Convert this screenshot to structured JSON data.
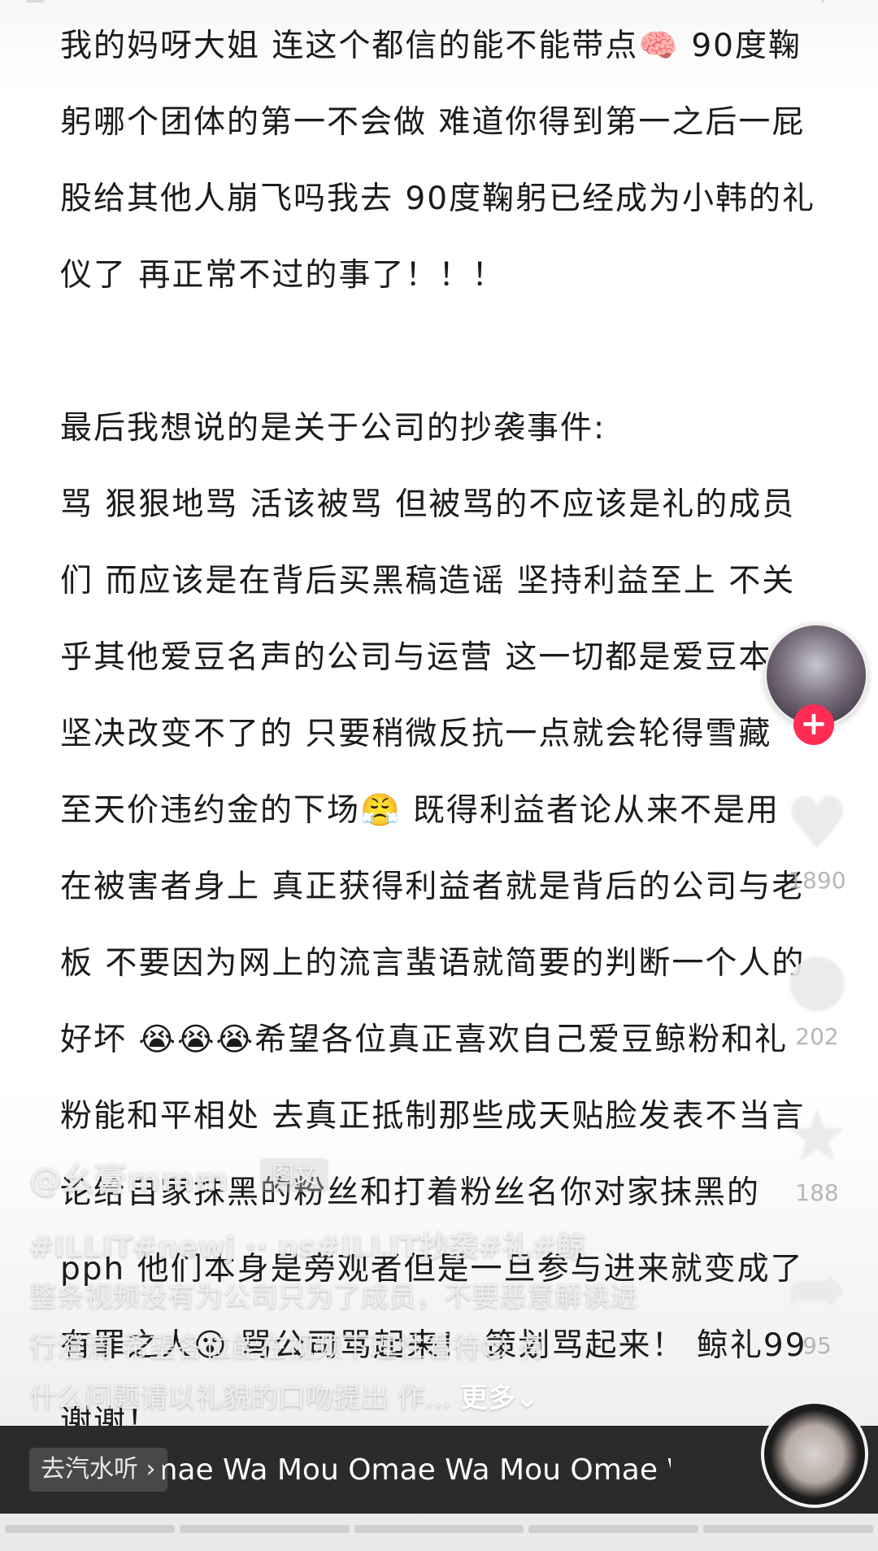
{
  "top_tabs": {
    "search_icon": "search-icon",
    "menu_icon": "menu-icon"
  },
  "article": {
    "lines_1": [
      "我的妈呀大姐 连这个都信的能不能带点🧠 90度鞠",
      "躬哪个团体的第一不会做 难道你得到第一之后一屁",
      "股给其他人崩飞吗我去 90度鞠躬已经成为小韩的礼",
      "仪了 再正常不过的事了！！！"
    ],
    "lines_2": [
      "最后我想说的是关于公司的抄袭事件:",
      "骂 狠狠地骂 活该被骂 但被骂的不应该是礼的成员",
      "们 而应该是在背后买黑稿造谣 坚持利益至上 不关",
      "乎其他爱豆名声的公司与运营 这一切都是爱豆本人",
      "坚决改变不了的 只要稍微反抗一点就会轮得雪藏",
      "至天价违约金的下场😤 既得利益者论从来不是用",
      "在被害者身上 真正获得利益者就是背后的公司与老",
      "板 不要因为网上的流言蜚语就简要的判断一个人的",
      "好坏 😭😭😭希望各位真正喜欢自己爱豆鲸粉和礼",
      "粉能和平相处 去真正抵制那些成天贴脸发表不当言",
      "论给自家抹黑的粉丝和打着粉丝名你对家抹黑的",
      "pph 他们本身是旁观者但是一旦参与进来就变成了",
      "有罪之人😮 骂公司骂起来！ 策划骂起来！ 鲸礼99",
      "谢谢！"
    ]
  },
  "rail": {
    "like_icon": "heart-icon",
    "like_count": "1890",
    "comment_icon": "comment-icon",
    "comment_count": "202",
    "favorite_icon": "star-icon",
    "favorite_count": "188",
    "share_icon": "share-icon",
    "share_count": "95",
    "follow_icon": "plus-icon"
  },
  "caption": {
    "author": "@幺膏mmm",
    "badge": "图文",
    "tags": "#ILLIT#newj ·· ns#ILLIT抄袭#礼#鲸",
    "desc_1": "整条视频没有为公司只为了成员，不要恶意解读进",
    "desc_2": "行澄清 希望各位能在视频下理性看待😎 有",
    "desc_3": "什么问题请以礼貌的口吻提出 作... ",
    "more": "更多⌄"
  },
  "music": {
    "label": "去汽水听 ›",
    "title": "Omae Wa Mou   Omae Wa Mou   Omae Wa Mou"
  },
  "colors": {
    "accent": "#fe2c55",
    "music_bar": "#2b2b2b"
  }
}
